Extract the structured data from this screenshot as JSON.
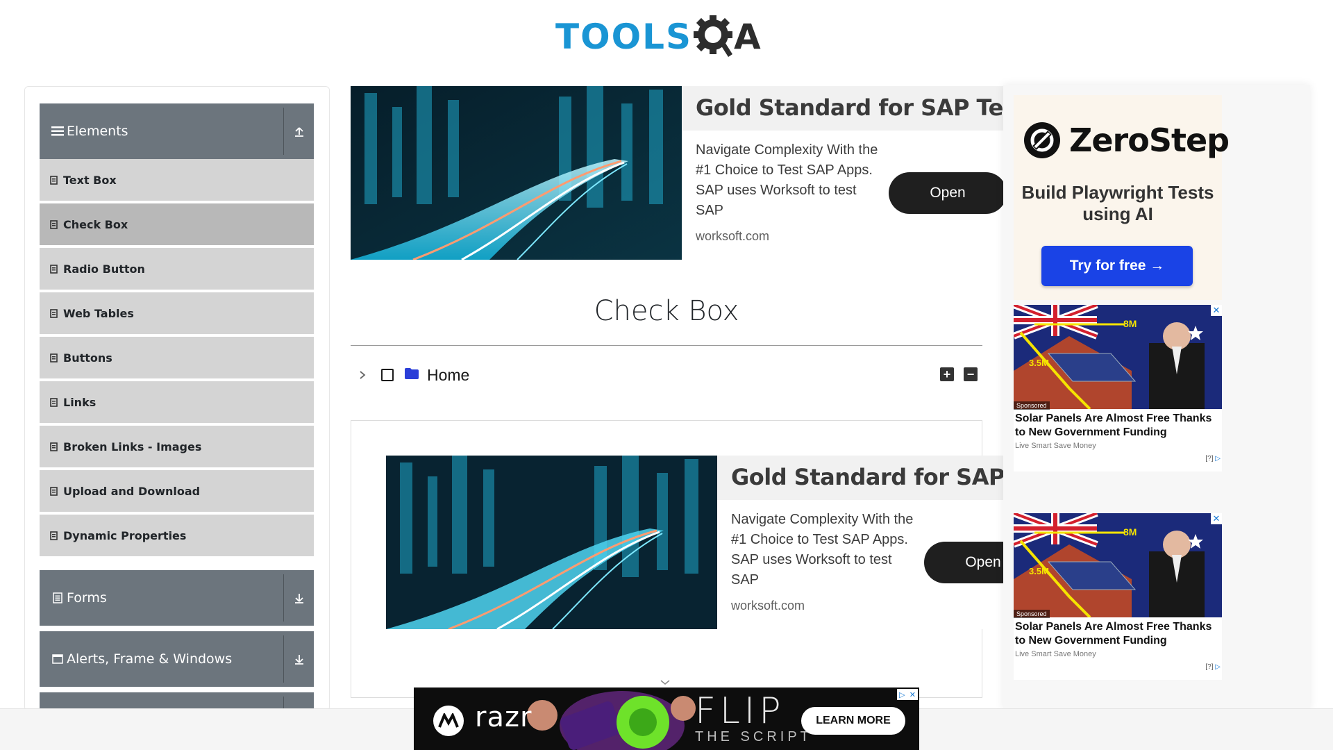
{
  "header": {
    "logo_text": "TOOLS",
    "logo_suffix": "A"
  },
  "sidebar": {
    "groups": [
      {
        "label": "Elements",
        "icon": "hamburger-icon",
        "toggle_icon": "collapse-up-icon",
        "expanded": true
      },
      {
        "label": "Forms",
        "icon": "form-icon",
        "toggle_icon": "expand-down-icon",
        "expanded": false
      },
      {
        "label": "Alerts, Frame & Windows",
        "icon": "window-icon",
        "toggle_icon": "expand-down-icon",
        "expanded": false
      }
    ],
    "items": [
      {
        "label": "Text Box"
      },
      {
        "label": "Check Box",
        "active": true
      },
      {
        "label": "Radio Button"
      },
      {
        "label": "Web Tables"
      },
      {
        "label": "Buttons"
      },
      {
        "label": "Links"
      },
      {
        "label": "Broken Links - Images"
      },
      {
        "label": "Upload and Download"
      },
      {
        "label": "Dynamic Properties"
      }
    ]
  },
  "ads": {
    "banner": {
      "title": "Gold Standard for SAP Testing",
      "description": "Navigate Complexity With the #1 Choice to Test SAP Apps. SAP uses Worksoft to test SAP",
      "domain": "worksoft.com",
      "button": "Open"
    },
    "zerostep": {
      "brand": "ZeroStep",
      "tagline": "Build Playwright Tests using AI",
      "button": "Try for free →"
    },
    "solar": {
      "headline": "Solar Panels Are Almost Free Thanks to New Government Funding",
      "source": "Live Smart Save Money",
      "sponsored": "Sponsored",
      "info": "[?]",
      "label_8m": "8M",
      "label_35m": "3.5M"
    },
    "razr": {
      "brand": "razr",
      "headline": "FLIP",
      "subline": "THE SCRIPT",
      "button": "LEARN MORE"
    }
  },
  "main": {
    "title": "Check Box",
    "tree": {
      "root_label": "Home",
      "expand_all": "+",
      "collapse_all": "−"
    }
  },
  "colors": {
    "accent_blue": "#1a95d4",
    "sidebar_header": "#6c757d",
    "sidebar_item": "#d4d4d4",
    "sidebar_item_active": "#b8b8b8",
    "folder": "#2a3ed8",
    "zerostep_button": "#1a43e6"
  }
}
